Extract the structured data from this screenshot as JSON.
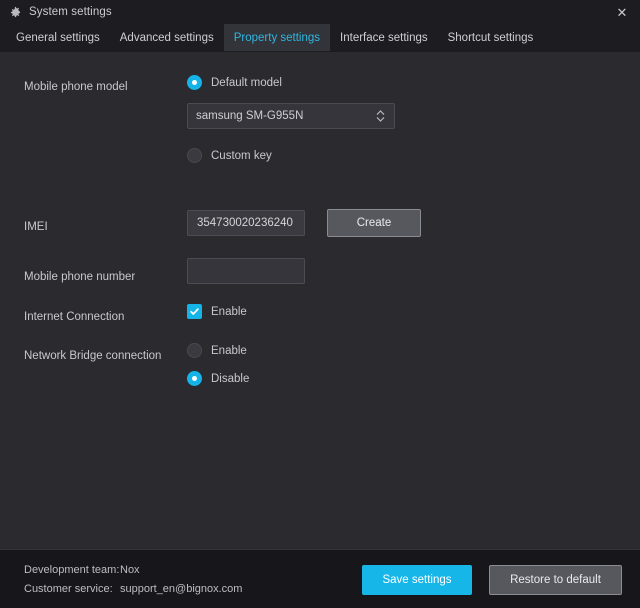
{
  "window": {
    "title": "System settings",
    "gear_icon": "gear-icon",
    "close_label": "✕"
  },
  "tabs": [
    {
      "label": "General settings",
      "active": false
    },
    {
      "label": "Advanced settings",
      "active": false
    },
    {
      "label": "Property settings",
      "active": true
    },
    {
      "label": "Interface settings",
      "active": false
    },
    {
      "label": "Shortcut settings",
      "active": false
    }
  ],
  "colors": {
    "accent": "#14b4e8",
    "window_bg": "#2a2a2f",
    "titlebar_bg": "#1c1c21",
    "footer_bg": "#17171b",
    "active_tab_text": "#2fb7e0"
  },
  "form": {
    "phone_model": {
      "label": "Mobile phone model",
      "default_model_option": "Default model",
      "default_model_selected": true,
      "model_select_value": "samsung SM-G955N",
      "custom_key_option": "Custom key",
      "custom_key_selected": false
    },
    "imei": {
      "label": "IMEI",
      "value": "354730020236240",
      "create_button": "Create"
    },
    "phone_number": {
      "label": "Mobile phone number",
      "value": "",
      "placeholder": ""
    },
    "internet_connection": {
      "label": "Internet Connection",
      "enable_label": "Enable",
      "enabled": true
    },
    "network_bridge": {
      "label": "Network Bridge connection",
      "enable_label": "Enable",
      "disable_label": "Disable",
      "selected": "disable"
    }
  },
  "footer": {
    "dev_team_key": "Development team:",
    "dev_team_value": "Nox",
    "support_key": "Customer service:",
    "support_value": "support_en@bignox.com",
    "save_button": "Save settings",
    "restore_button": "Restore to default"
  }
}
